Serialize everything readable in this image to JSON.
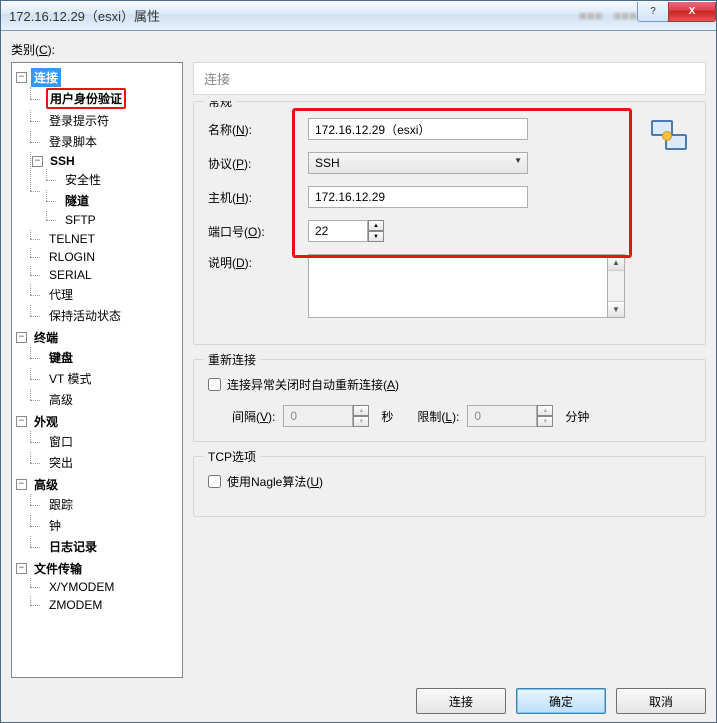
{
  "titlebar": {
    "title": "172.16.12.29（esxi）属性"
  },
  "tb_btn": {
    "help": "?",
    "close": "X"
  },
  "category_label_pre": "类别(",
  "category_label_u": "C",
  "category_label_post": "):",
  "tree": {
    "root": "连接",
    "user_auth": "用户身份验证",
    "login_prompt": "登录提示符",
    "login_script": "登录脚本",
    "ssh": "SSH",
    "ssh_security": "安全性",
    "ssh_tunnel": "隧道",
    "ssh_sftp": "SFTP",
    "telnet": "TELNET",
    "rlogin": "RLOGIN",
    "serial": "SERIAL",
    "proxy": "代理",
    "keep_alive": "保持活动状态",
    "terminal": "终端",
    "keyboard": "键盘",
    "vt_mode": "VT 模式",
    "advanced1": "高级",
    "appearance": "外观",
    "window": "窗口",
    "highlight": "突出",
    "advanced2": "高级",
    "trace": "跟踪",
    "bell": "钟",
    "logging": "日志记录",
    "file_transfer": "文件传输",
    "xymodem": "X/YMODEM",
    "zmodem": "ZMODEM"
  },
  "section_title": "连接",
  "group_general": "常规",
  "labels": {
    "name_pre": "名称(",
    "name_u": "N",
    "name_post": "):",
    "proto_pre": "协议(",
    "proto_u": "P",
    "proto_post": "):",
    "host_pre": "主机(",
    "host_u": "H",
    "host_post": "):",
    "port_pre": "端口号(",
    "port_u": "O",
    "port_post": "):",
    "desc_pre": "说明(",
    "desc_u": "D",
    "desc_post": "):"
  },
  "values": {
    "name": "172.16.12.29（esxi）",
    "protocol": "SSH",
    "host": "172.16.12.29",
    "port": "22",
    "description": ""
  },
  "group_reconnect": "重新连接",
  "reconnect_chk_pre": "连接异常关闭时自动重新连接(",
  "reconnect_chk_u": "A",
  "reconnect_chk_post": ")",
  "interval_pre": "间隔(",
  "interval_u": "V",
  "interval_post": "):",
  "interval_val": "0",
  "interval_unit": "秒",
  "limit_pre": "限制(",
  "limit_u": "L",
  "limit_post": "):",
  "limit_val": "0",
  "limit_unit": "分钟",
  "group_tcp": "TCP选项",
  "nagle_pre": "使用Nagle算法(",
  "nagle_u": "U",
  "nagle_post": ")",
  "buttons": {
    "connect": "连接",
    "ok": "确定",
    "cancel": "取消"
  }
}
